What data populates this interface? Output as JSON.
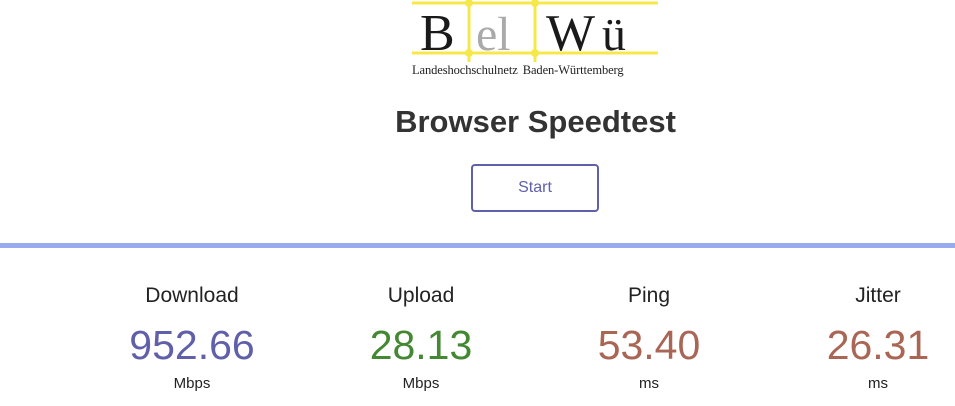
{
  "logo": {
    "letters": [
      "B",
      "el",
      "W",
      "ü"
    ],
    "caption_left": "Landeshochschulnetz",
    "caption_right": "Baden-Württemberg",
    "colors": {
      "frame": "#f5e84a",
      "node": "#f5e84a",
      "letter_dark": "#1a1a1a",
      "letter_grey": "#aaaaaa"
    }
  },
  "title": "Browser Speedtest",
  "start_button": {
    "label": "Start",
    "color": "#6060aa"
  },
  "divider_color": "#99aaee",
  "metrics": [
    {
      "label": "Download",
      "value": "952.66",
      "unit": "Mbps",
      "color": "#6060aa"
    },
    {
      "label": "Upload",
      "value": "28.13",
      "unit": "Mbps",
      "color": "#448833"
    },
    {
      "label": "Ping",
      "value": "53.40",
      "unit": "ms",
      "color": "#aa6655"
    },
    {
      "label": "Jitter",
      "value": "26.31",
      "unit": "ms",
      "color": "#aa6655"
    }
  ]
}
